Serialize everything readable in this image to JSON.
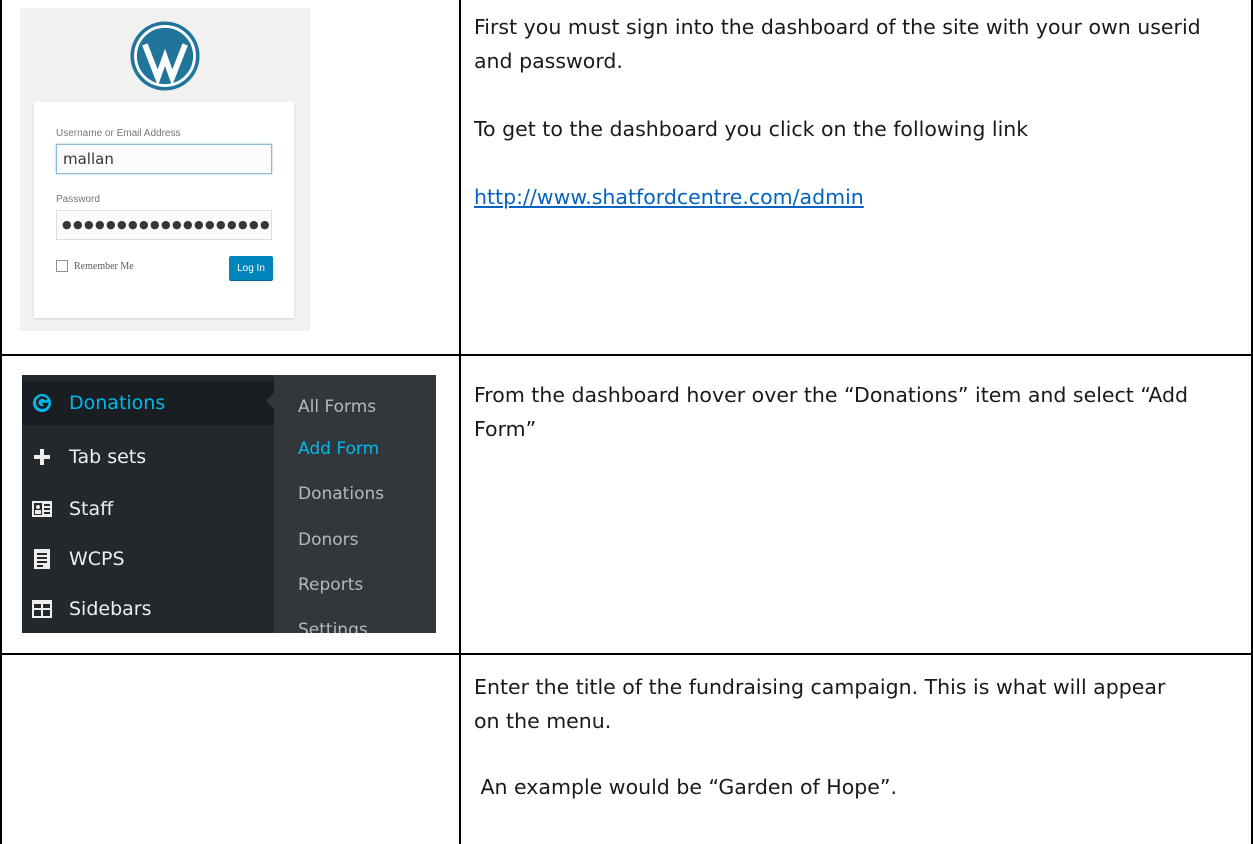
{
  "login": {
    "username_label": "Username or Email Address",
    "username_value": "mallan",
    "password_label": "Password",
    "password_mask": "●●●●●●●●●●●●●●●●●●●",
    "remember_label": "Remember Me",
    "login_button": "Log In"
  },
  "admin_menu": {
    "items": [
      {
        "label": "Donations",
        "icon": "give-icon",
        "active": true
      },
      {
        "label": "Tab sets",
        "icon": "plus-icon"
      },
      {
        "label": "Staff",
        "icon": "id-card-icon"
      },
      {
        "label": "WCPS",
        "icon": "document-icon"
      },
      {
        "label": "Sidebars",
        "icon": "layout-icon"
      }
    ],
    "submenu": [
      "All Forms",
      "Add Form",
      "Donations",
      "Donors",
      "Reports",
      "Settings"
    ]
  },
  "instructions": {
    "row1_p1": "First you must sign into the dashboard of the site with your own userid and password.",
    "row1_p2": "To get to the dashboard you click on the following link",
    "row1_link": "http://www.shatfordcentre.com/admin",
    "row2_p1": "From the dashboard hover over the “Donations” item and select “Add Form”",
    "row3_p1": "Enter the title of the fundraising campaign. This is what will appear on the menu.",
    "row3_p2": " An example would be “Garden of Hope”."
  },
  "colors": {
    "wp_blue": "#21759b",
    "admin_dark": "#23282d",
    "admin_submenu": "#32373c",
    "admin_highlight": "#00b9eb",
    "link": "#0563c1"
  }
}
